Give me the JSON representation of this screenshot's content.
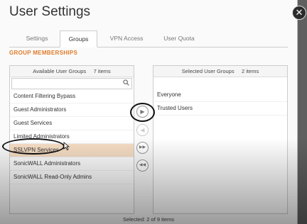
{
  "dialog": {
    "title": "User Settings",
    "close_glyph": "✕"
  },
  "tabs": [
    {
      "label": "Settings"
    },
    {
      "label": "Groups"
    },
    {
      "label": "VPN Access"
    },
    {
      "label": "User Quota"
    }
  ],
  "active_tab": "Groups",
  "section_title": "GROUP MEMBERSHIPS",
  "available": {
    "title": "Available User Groups",
    "count": "7 items",
    "search_placeholder": "",
    "items": [
      "Content Filtering Bypass",
      "Guest Administrators",
      "Guest Services",
      "Limited Administrators",
      "SSLVPN Services",
      "SonicWALL Administrators",
      "SonicWALL Read-Only Admins"
    ],
    "hovered_item": "SSLVPN Services"
  },
  "selected": {
    "title": "Selected User Groups",
    "count": "2 items",
    "search_placeholder": "",
    "items": [
      "Everyone",
      "Trusted Users"
    ]
  },
  "arrows": {
    "add": "▶",
    "remove": "◀",
    "add_all": "▶▶",
    "remove_all": "◀◀"
  },
  "footer": "Selected: 2 of 9 items",
  "icons": {
    "search": "search-icon",
    "close": "close-icon"
  },
  "colors": {
    "accent": "#e07b2a",
    "hover_row": "#f6ddc4"
  }
}
